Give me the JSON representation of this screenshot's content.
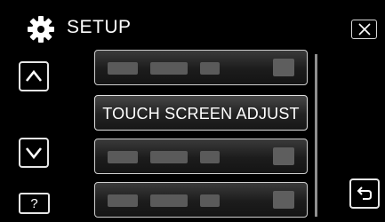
{
  "header": {
    "icon": "gear-icon",
    "title": "SETUP",
    "close_icon": "close-icon"
  },
  "sidebar": {
    "up_icon": "chevron-up-icon",
    "down_icon": "chevron-down-icon",
    "help_label": "?"
  },
  "menu": {
    "items": [
      {
        "label": "",
        "obscured": true
      },
      {
        "label": "TOUCH SCREEN ADJUST",
        "obscured": false
      },
      {
        "label": "",
        "obscured": true
      },
      {
        "label": "",
        "obscured": true
      }
    ]
  },
  "footer": {
    "back_icon": "back-arrow-icon"
  }
}
